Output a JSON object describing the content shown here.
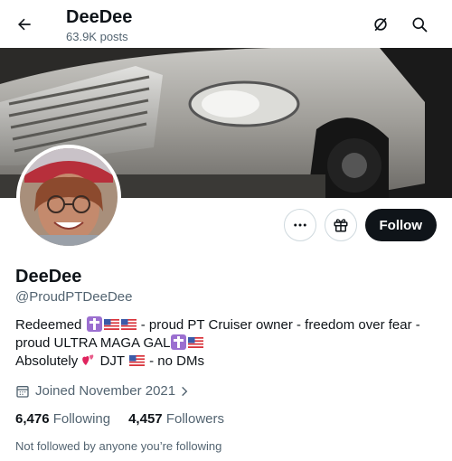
{
  "header": {
    "name": "DeeDee",
    "posts": "63.9K posts"
  },
  "actions": {
    "follow_label": "Follow"
  },
  "profile": {
    "display_name": "DeeDee",
    "handle": "@ProudPTDeeDee",
    "bio": {
      "line1_a": "Redeemed",
      "line1_b": "- proud PT Cruiser owner - freedom over fear -",
      "line2_a": "proud ULTRA MAGA GAL",
      "line3_a": "Absolutely",
      "line3_b": "DJT",
      "line3_c": "-  no DMs"
    },
    "joined": "Joined November 2021",
    "following_count": "6,476",
    "following_label": "Following",
    "followers_count": "4,457",
    "followers_label": "Followers",
    "not_followed": "Not followed by anyone you’re following"
  },
  "icons": {
    "back": "arrow-left-icon",
    "grok": "slashed-circle-icon",
    "search": "search-icon",
    "more": "more-dots-icon",
    "gift": "gift-icon",
    "calendar": "calendar-icon",
    "chevron": "chevron-right-icon",
    "cross_emoji": "latin-cross-icon",
    "flag_emoji": "us-flag-icon",
    "heart_emoji": "two-hearts-icon"
  },
  "colors": {
    "follow_bg": "#0f1419",
    "secondary_text": "#536471",
    "border": "#cfd9de",
    "cross_purple": "#9b6fd0"
  }
}
